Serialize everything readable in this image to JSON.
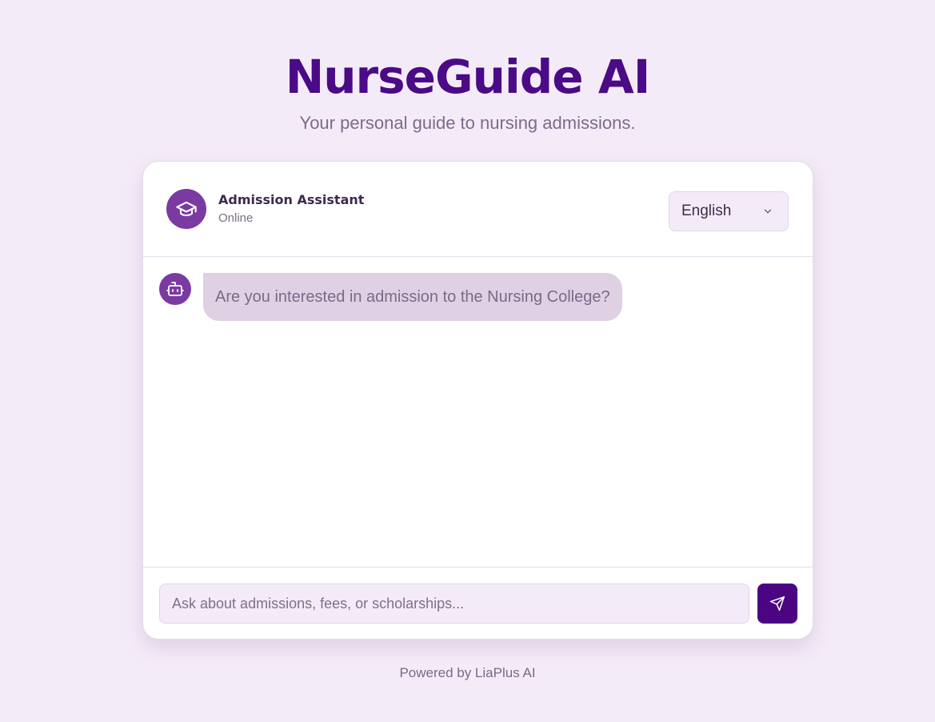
{
  "hero": {
    "title": "NurseGuide AI",
    "subtitle": "Your personal guide to nursing admissions."
  },
  "chat": {
    "header": {
      "avatar_icon": "graduation-cap-icon",
      "name": "Admission Assistant",
      "status": "Online",
      "language": {
        "selected": "English",
        "icon": "chevron-down-icon"
      }
    },
    "messages": [
      {
        "sender": "bot",
        "avatar_icon": "robot-icon",
        "text": "Are you interested in admission to the Nursing College?"
      }
    ],
    "composer": {
      "placeholder": "Ask about admissions, fees, or scholarships...",
      "value": "",
      "send_icon": "send-icon"
    }
  },
  "footer": {
    "text": "Powered by LiaPlus AI"
  },
  "colors": {
    "background": "#f4ebf8",
    "brand": "#4b0a86",
    "avatar": "#7a3aa2",
    "bubble": "#e0d0e4",
    "send_button": "#4b0583"
  }
}
